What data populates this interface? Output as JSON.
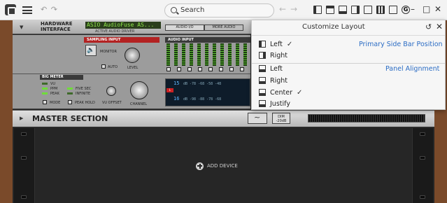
{
  "titlebar": {
    "search_placeholder": "Search",
    "undo_glyph": "↶ ↷",
    "nav_glyph": "←→"
  },
  "hardware": {
    "title_line1": "HARDWARE",
    "title_line2": "INTERFACE",
    "driver_name": "ASIO AudioFuse AS...",
    "driver_caption": "ACTIVE AUDIO DRIVER",
    "audio_io_button": "AUDIO I/O",
    "more_audio_button": "MORE AUDIO"
  },
  "sampling": {
    "section_label": "SAMPLING INPUT",
    "monitor_label": "MONITOR",
    "auto_label": "AUTO",
    "level_label": "LEVEL"
  },
  "audio_input": {
    "section_label": "AUDIO INPUT",
    "channels": [
      "1",
      "2",
      "3",
      "4",
      "5",
      "6",
      "7",
      "8",
      "9",
      "10",
      "11"
    ]
  },
  "big_meter": {
    "section_label": "BIG METER",
    "options_left": [
      "VU",
      "PPM",
      "PEAK"
    ],
    "options_right": [
      "FIVE SEC",
      "INFINITE"
    ],
    "mode_label": "MODE",
    "peak_hold_label": "PEAK HOLD",
    "vu_offset_label": "VU OFFSET",
    "channel_label": "CHANNEL",
    "ch_top": "15",
    "ch_bottom": "16",
    "scale_top": "dB  -78   -68   -58   -48",
    "scale_bottom": "dB  -98   -88   -78   -68"
  },
  "master": {
    "title": "MASTER SECTION",
    "dim_label_line1": "DIM",
    "dim_label_line2": "-20dB"
  },
  "rack": {
    "add_device_label": "ADD DEVICE"
  },
  "customize_panel": {
    "title": "Customize Layout",
    "side_bar_section": "Primary Side Bar Position",
    "side_bar_options": [
      {
        "label": "Left",
        "icon": "sidebar-left-icon",
        "checked": true
      },
      {
        "label": "Right",
        "icon": "sidebar-right-icon",
        "checked": false
      }
    ],
    "panel_section": "Panel Alignment",
    "panel_options": [
      {
        "label": "Left",
        "icon": "panel-align-left-icon",
        "checked": false
      },
      {
        "label": "Right",
        "icon": "panel-align-right-icon",
        "checked": false
      },
      {
        "label": "Center",
        "icon": "panel-align-center-icon",
        "checked": true
      },
      {
        "label": "Justify",
        "icon": "panel-align-justify-icon",
        "checked": false
      }
    ],
    "check_glyph": "✓",
    "reset_glyph": "↺",
    "close_glyph": "✕"
  },
  "colors": {
    "accent": "#2b6cc4",
    "panel_bg": "#f6f6f6",
    "rack_wood": "#7a4a2a",
    "lcd_green": "#8ee64a"
  }
}
